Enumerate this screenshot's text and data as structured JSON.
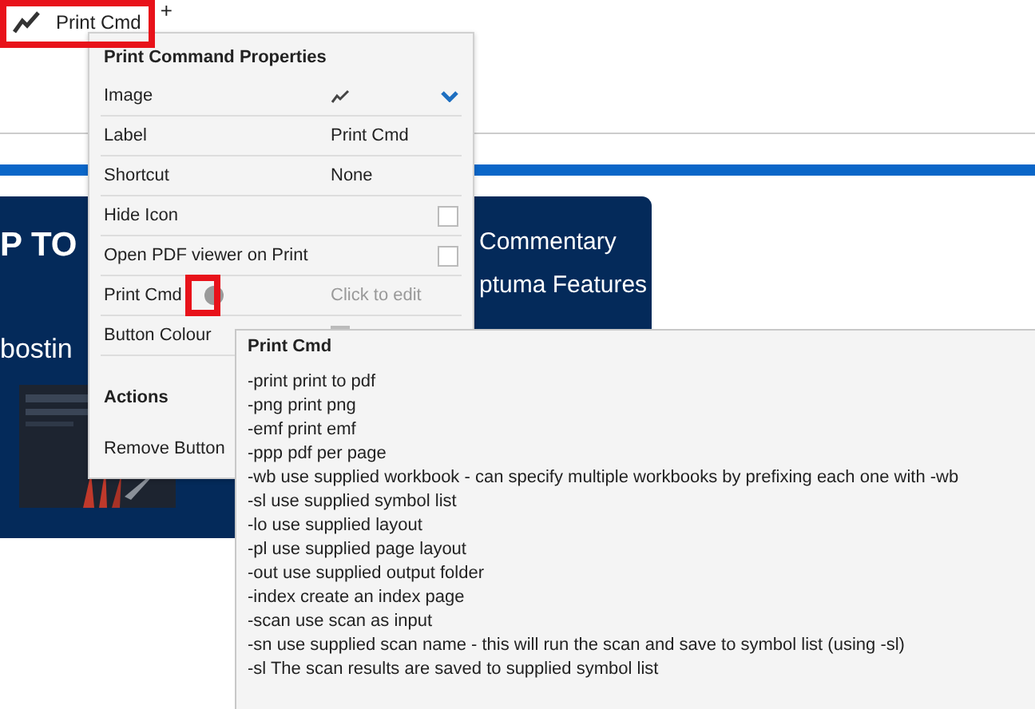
{
  "toolbar": {
    "button": {
      "label": "Print Cmd"
    },
    "add_label": "+"
  },
  "properties_panel": {
    "title": "Print Command Properties",
    "rows": [
      {
        "label": "Image"
      },
      {
        "kind": "text",
        "label": "Label",
        "value": "Print Cmd"
      },
      {
        "kind": "text",
        "label": "Shortcut",
        "value": "None"
      },
      {
        "kind": "checkbox",
        "label": "Hide Icon",
        "checked": false
      },
      {
        "kind": "checkbox",
        "label": "Open PDF viewer on Print",
        "checked": false
      },
      {
        "kind": "info",
        "label": "Print Cmd",
        "placeholder": "Click to edit"
      },
      {
        "kind": "color",
        "label": "Button Colour"
      }
    ],
    "actions_title": "Actions",
    "actions": [
      "Remove Button"
    ]
  },
  "banner": {
    "heading": "P TO",
    "subheading": "bostin",
    "links": [
      "Commentary",
      "ptuma Features"
    ]
  },
  "tooltip": {
    "title": "Print Cmd",
    "lines": [
      "-print  print to pdf",
      "-png  print png",
      "-emf  print emf",
      "-ppp  pdf per page",
      "-wb  use supplied workbook - can specify multiple workbooks by prefixing each one with -wb",
      "-sl  use supplied symbol list",
      "-lo  use supplied layout",
      "-pl  use supplied page layout",
      "-out  use supplied output folder",
      "-index  create an index page",
      "-scan  use scan as input",
      "-sn  use supplied scan name - this will run the scan and save to symbol list (using -sl)",
      "-sl  The scan results are saved to supplied symbol list"
    ]
  }
}
